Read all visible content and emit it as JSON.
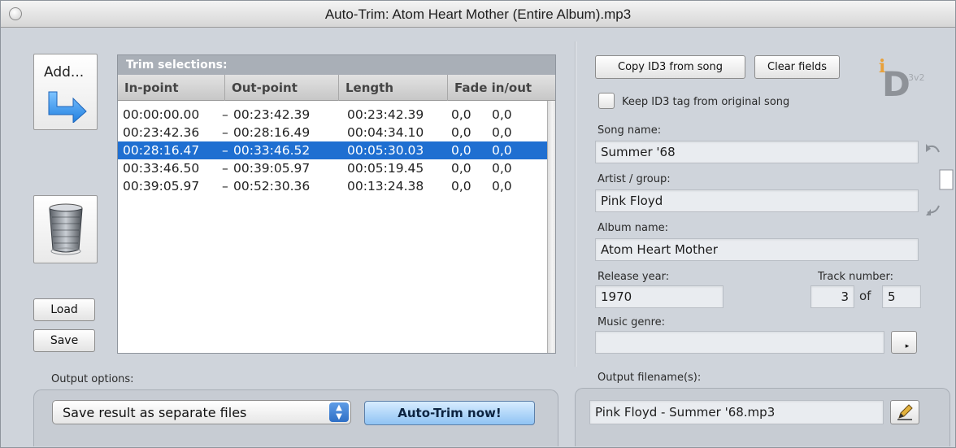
{
  "window": {
    "title": "Auto-Trim: Atom Heart Mother (Entire Album).mp3"
  },
  "left": {
    "add_label": "Add...",
    "load_label": "Load",
    "save_label": "Save"
  },
  "trim": {
    "title": "Trim selections:",
    "columns": [
      "In-point",
      "Out-point",
      "Length",
      "Fade in/out"
    ],
    "rows": [
      {
        "in": "00:00:00.00",
        "dash": "–",
        "out": "00:23:42.39",
        "length": "00:23:42.39",
        "fade_in": "0,0",
        "fade_out": "0,0",
        "selected": false
      },
      {
        "in": "00:23:42.36",
        "dash": "–",
        "out": "00:28:16.49",
        "length": "00:04:34.10",
        "fade_in": "0,0",
        "fade_out": "0,0",
        "selected": false
      },
      {
        "in": "00:28:16.47",
        "dash": "–",
        "out": "00:33:46.52",
        "length": "00:05:30.03",
        "fade_in": "0,0",
        "fade_out": "0,0",
        "selected": true
      },
      {
        "in": "00:33:46.50",
        "dash": "–",
        "out": "00:39:05.97",
        "length": "00:05:19.45",
        "fade_in": "0,0",
        "fade_out": "0,0",
        "selected": false
      },
      {
        "in": "00:39:05.97",
        "dash": "–",
        "out": "00:52:30.36",
        "length": "00:13:24.38",
        "fade_in": "0,0",
        "fade_out": "0,0",
        "selected": false
      }
    ]
  },
  "output": {
    "options_label": "Output options:",
    "mode_value": "Save result as separate files",
    "autotrim_label": "Auto-Trim now!",
    "filename_label": "Output filename(s):",
    "filename_value": "Pink Floyd - Summer '68.mp3"
  },
  "id3": {
    "copy_label": "Copy ID3 from song",
    "clear_label": "Clear fields",
    "keep_label": "Keep ID3 tag from original song",
    "logo_letter": "i",
    "logo_d": "D",
    "logo_version": "3v2",
    "song_label": "Song name:",
    "song_value": "Summer '68",
    "artist_label": "Artist / group:",
    "artist_value": "Pink Floyd",
    "album_label": "Album name:",
    "album_value": "Atom Heart Mother",
    "year_label": "Release year:",
    "year_value": "1970",
    "track_label": "Track number:",
    "track_value": "3",
    "of_label": "of",
    "total_value": "5",
    "genre_label": "Music genre:",
    "genre_value": ""
  },
  "colors": {
    "selection": "#1f6fd1",
    "accent_button": "#8fc3f3",
    "window_bg": "#cfd4db"
  },
  "icons": [
    "add-arrow-icon",
    "trash-can-icon",
    "swap-arrows-icon",
    "pencil-icon",
    "dropdown-arrow-icon",
    "id3-logo-icon"
  ]
}
